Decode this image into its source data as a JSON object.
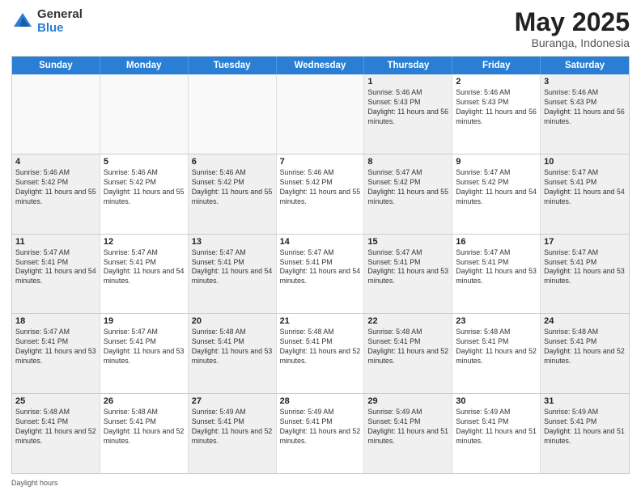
{
  "logo": {
    "general": "General",
    "blue": "Blue"
  },
  "title": {
    "month": "May 2025",
    "location": "Buranga, Indonesia"
  },
  "days_of_week": [
    "Sunday",
    "Monday",
    "Tuesday",
    "Wednesday",
    "Thursday",
    "Friday",
    "Saturday"
  ],
  "footer": {
    "daylight": "Daylight hours"
  },
  "weeks": [
    [
      {
        "day": "",
        "empty": true
      },
      {
        "day": "",
        "empty": true
      },
      {
        "day": "",
        "empty": true
      },
      {
        "day": "",
        "empty": true
      },
      {
        "day": "1",
        "sunrise": "5:46 AM",
        "sunset": "5:43 PM",
        "daylight": "11 hours and 56 minutes."
      },
      {
        "day": "2",
        "sunrise": "5:46 AM",
        "sunset": "5:43 PM",
        "daylight": "11 hours and 56 minutes."
      },
      {
        "day": "3",
        "sunrise": "5:46 AM",
        "sunset": "5:43 PM",
        "daylight": "11 hours and 56 minutes."
      }
    ],
    [
      {
        "day": "4",
        "sunrise": "5:46 AM",
        "sunset": "5:42 PM",
        "daylight": "11 hours and 55 minutes."
      },
      {
        "day": "5",
        "sunrise": "5:46 AM",
        "sunset": "5:42 PM",
        "daylight": "11 hours and 55 minutes."
      },
      {
        "day": "6",
        "sunrise": "5:46 AM",
        "sunset": "5:42 PM",
        "daylight": "11 hours and 55 minutes."
      },
      {
        "day": "7",
        "sunrise": "5:46 AM",
        "sunset": "5:42 PM",
        "daylight": "11 hours and 55 minutes."
      },
      {
        "day": "8",
        "sunrise": "5:47 AM",
        "sunset": "5:42 PM",
        "daylight": "11 hours and 55 minutes."
      },
      {
        "day": "9",
        "sunrise": "5:47 AM",
        "sunset": "5:42 PM",
        "daylight": "11 hours and 54 minutes."
      },
      {
        "day": "10",
        "sunrise": "5:47 AM",
        "sunset": "5:41 PM",
        "daylight": "11 hours and 54 minutes."
      }
    ],
    [
      {
        "day": "11",
        "sunrise": "5:47 AM",
        "sunset": "5:41 PM",
        "daylight": "11 hours and 54 minutes."
      },
      {
        "day": "12",
        "sunrise": "5:47 AM",
        "sunset": "5:41 PM",
        "daylight": "11 hours and 54 minutes."
      },
      {
        "day": "13",
        "sunrise": "5:47 AM",
        "sunset": "5:41 PM",
        "daylight": "11 hours and 54 minutes."
      },
      {
        "day": "14",
        "sunrise": "5:47 AM",
        "sunset": "5:41 PM",
        "daylight": "11 hours and 54 minutes."
      },
      {
        "day": "15",
        "sunrise": "5:47 AM",
        "sunset": "5:41 PM",
        "daylight": "11 hours and 53 minutes."
      },
      {
        "day": "16",
        "sunrise": "5:47 AM",
        "sunset": "5:41 PM",
        "daylight": "11 hours and 53 minutes."
      },
      {
        "day": "17",
        "sunrise": "5:47 AM",
        "sunset": "5:41 PM",
        "daylight": "11 hours and 53 minutes."
      }
    ],
    [
      {
        "day": "18",
        "sunrise": "5:47 AM",
        "sunset": "5:41 PM",
        "daylight": "11 hours and 53 minutes."
      },
      {
        "day": "19",
        "sunrise": "5:47 AM",
        "sunset": "5:41 PM",
        "daylight": "11 hours and 53 minutes."
      },
      {
        "day": "20",
        "sunrise": "5:48 AM",
        "sunset": "5:41 PM",
        "daylight": "11 hours and 53 minutes."
      },
      {
        "day": "21",
        "sunrise": "5:48 AM",
        "sunset": "5:41 PM",
        "daylight": "11 hours and 52 minutes."
      },
      {
        "day": "22",
        "sunrise": "5:48 AM",
        "sunset": "5:41 PM",
        "daylight": "11 hours and 52 minutes."
      },
      {
        "day": "23",
        "sunrise": "5:48 AM",
        "sunset": "5:41 PM",
        "daylight": "11 hours and 52 minutes."
      },
      {
        "day": "24",
        "sunrise": "5:48 AM",
        "sunset": "5:41 PM",
        "daylight": "11 hours and 52 minutes."
      }
    ],
    [
      {
        "day": "25",
        "sunrise": "5:48 AM",
        "sunset": "5:41 PM",
        "daylight": "11 hours and 52 minutes."
      },
      {
        "day": "26",
        "sunrise": "5:48 AM",
        "sunset": "5:41 PM",
        "daylight": "11 hours and 52 minutes."
      },
      {
        "day": "27",
        "sunrise": "5:49 AM",
        "sunset": "5:41 PM",
        "daylight": "11 hours and 52 minutes."
      },
      {
        "day": "28",
        "sunrise": "5:49 AM",
        "sunset": "5:41 PM",
        "daylight": "11 hours and 52 minutes."
      },
      {
        "day": "29",
        "sunrise": "5:49 AM",
        "sunset": "5:41 PM",
        "daylight": "11 hours and 51 minutes."
      },
      {
        "day": "30",
        "sunrise": "5:49 AM",
        "sunset": "5:41 PM",
        "daylight": "11 hours and 51 minutes."
      },
      {
        "day": "31",
        "sunrise": "5:49 AM",
        "sunset": "5:41 PM",
        "daylight": "11 hours and 51 minutes."
      }
    ]
  ]
}
